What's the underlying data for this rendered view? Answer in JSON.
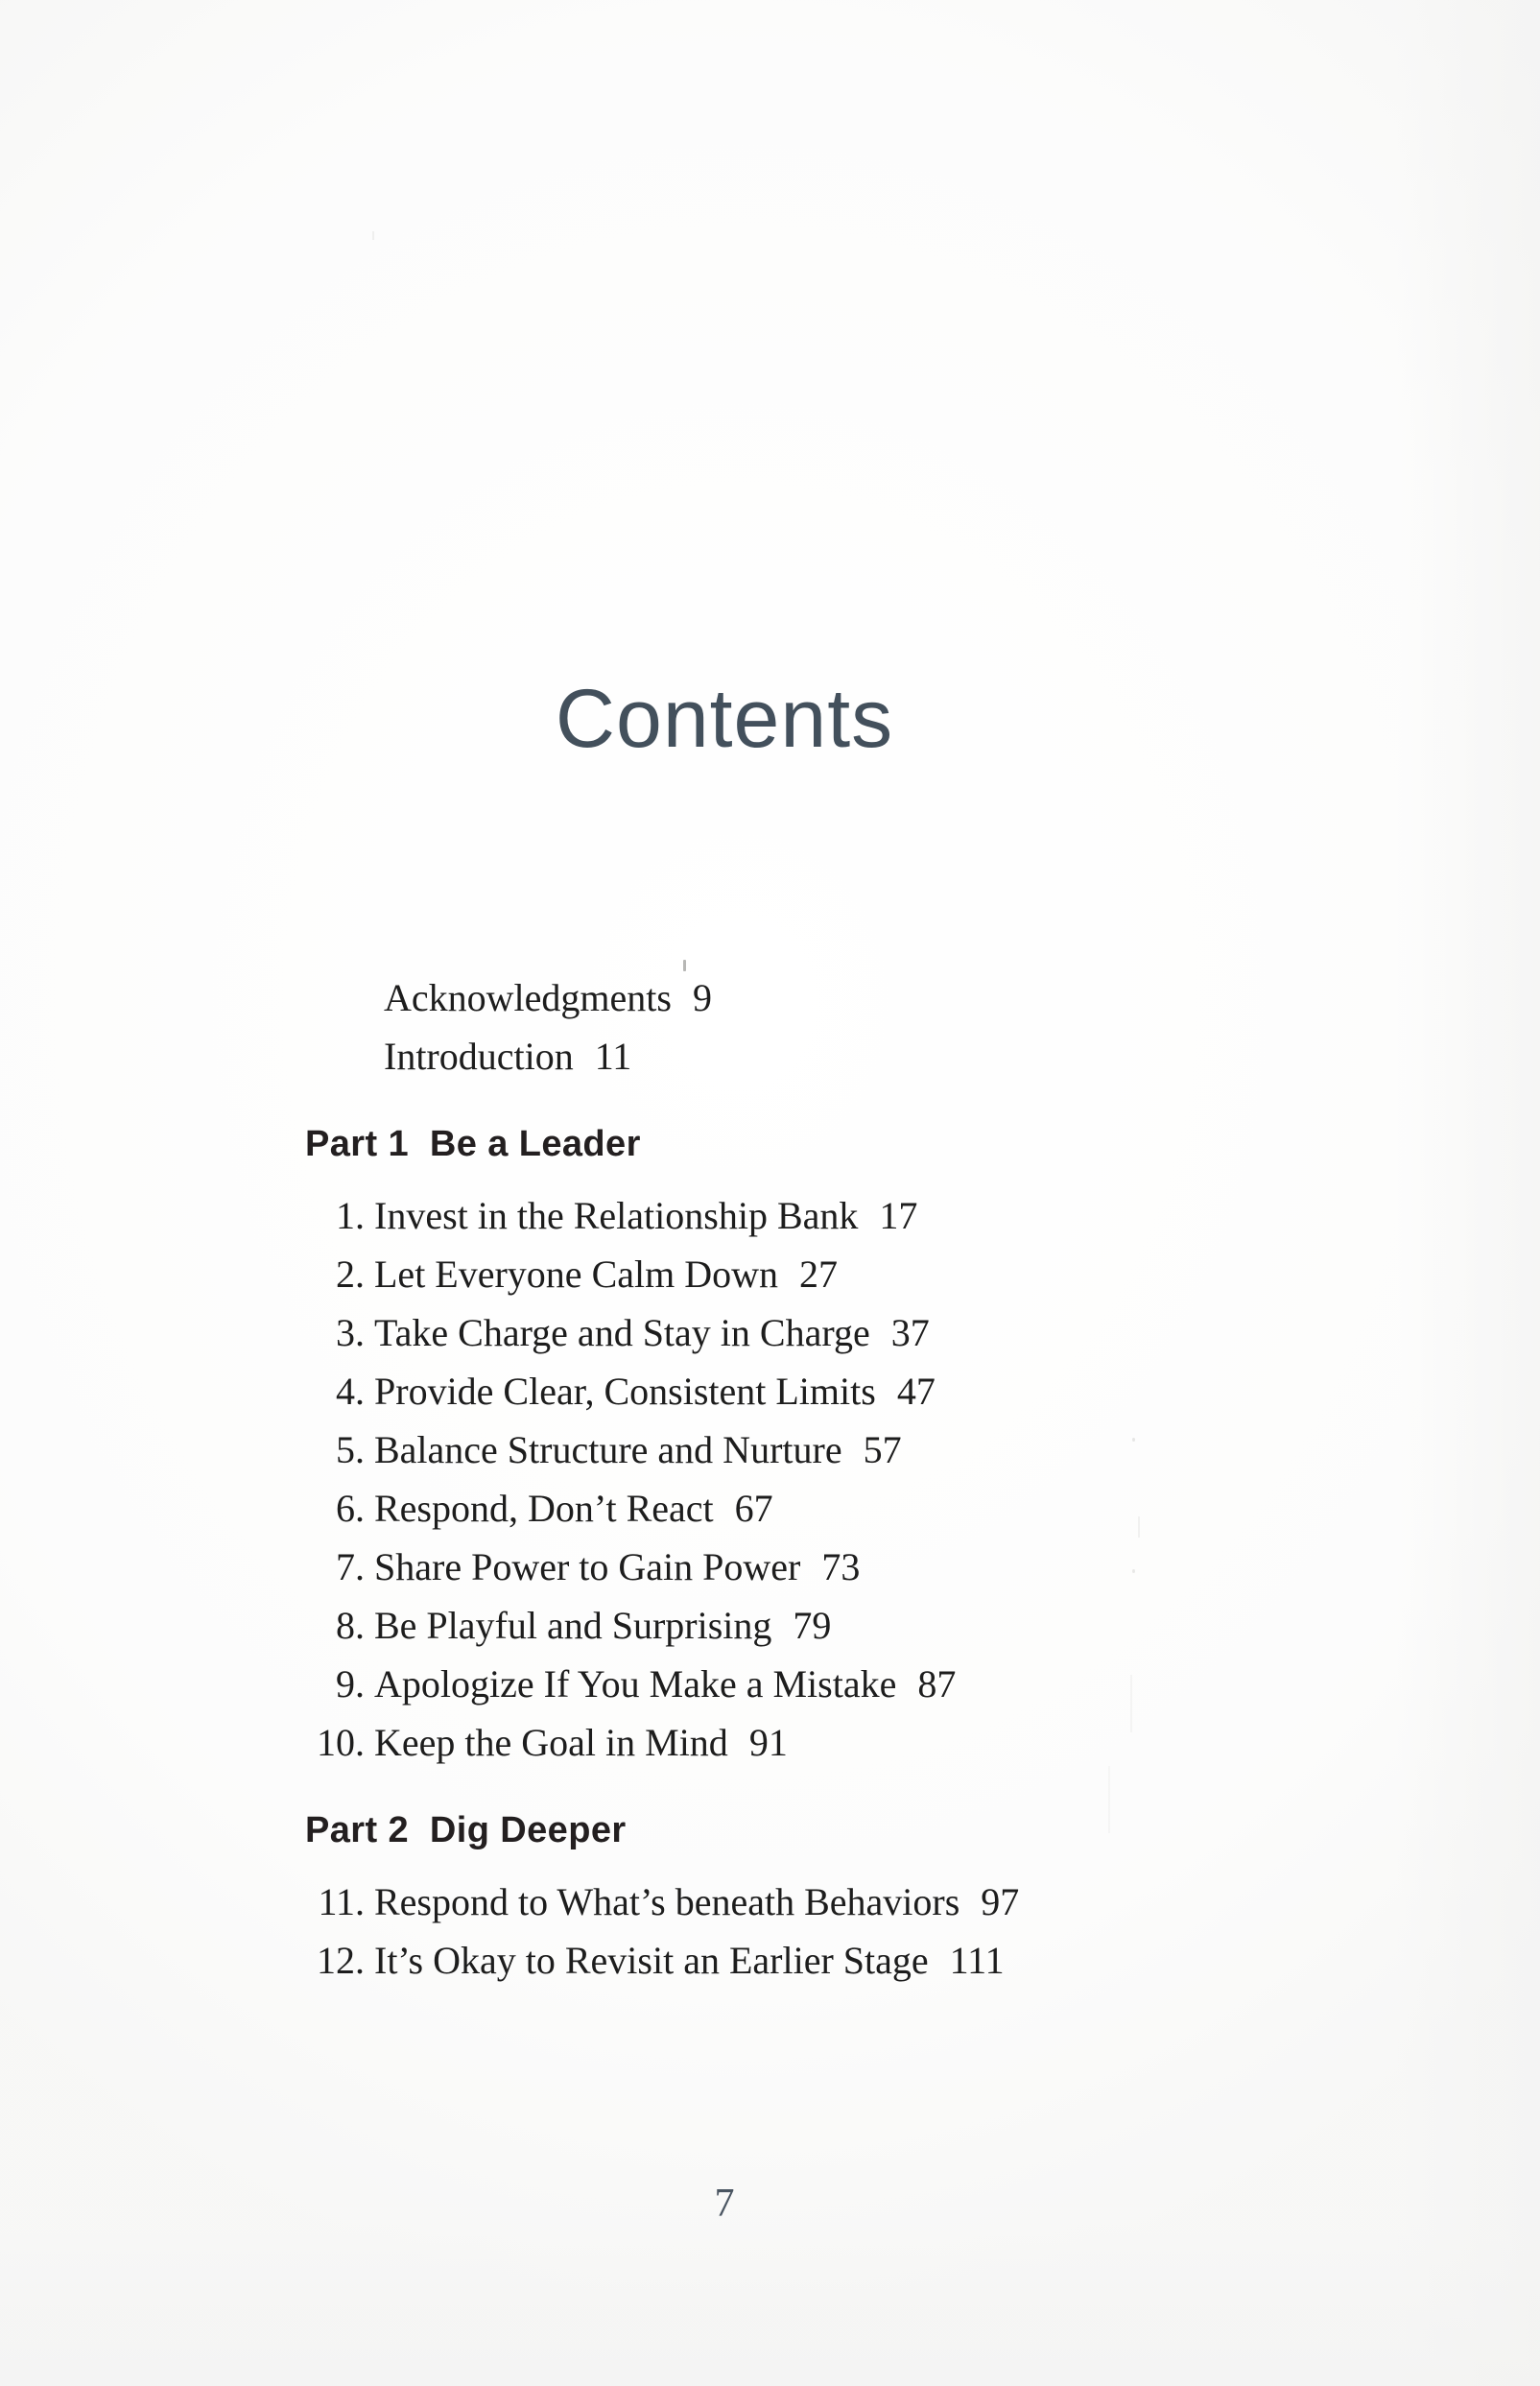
{
  "page": {
    "title": "Contents",
    "folio": "7",
    "title_color": "#43505c",
    "body_color": "#1d1d1d",
    "heading_color": "#231f20"
  },
  "front_matter": [
    {
      "label": "Acknowledgments",
      "page": "9"
    },
    {
      "label": "Introduction",
      "page": "11"
    }
  ],
  "parts": [
    {
      "heading": "Part 1  Be a Leader",
      "chapters": [
        {
          "num": "1.",
          "title": "Invest in the Relationship Bank",
          "page": "17"
        },
        {
          "num": "2.",
          "title": "Let Everyone Calm Down",
          "page": "27"
        },
        {
          "num": "3.",
          "title": "Take Charge and Stay in Charge",
          "page": "37"
        },
        {
          "num": "4.",
          "title": "Provide Clear, Consistent Limits",
          "page": "47"
        },
        {
          "num": "5.",
          "title": "Balance Structure and Nurture",
          "page": "57"
        },
        {
          "num": "6.",
          "title": "Respond, Don’t React",
          "page": "67"
        },
        {
          "num": "7.",
          "title": "Share Power to Gain Power",
          "page": "73"
        },
        {
          "num": "8.",
          "title": "Be Playful and Surprising",
          "page": "79"
        },
        {
          "num": "9.",
          "title": "Apologize If You Make a Mistake",
          "page": "87"
        },
        {
          "num": "10.",
          "title": "Keep the Goal in Mind",
          "page": "91"
        }
      ]
    },
    {
      "heading": "Part 2  Dig Deeper",
      "chapters": [
        {
          "num": "11.",
          "title": "Respond to What’s beneath Behaviors",
          "page": "97"
        },
        {
          "num": "12.",
          "title": "It’s Okay to Revisit an Earlier Stage",
          "page": "111"
        }
      ]
    }
  ]
}
